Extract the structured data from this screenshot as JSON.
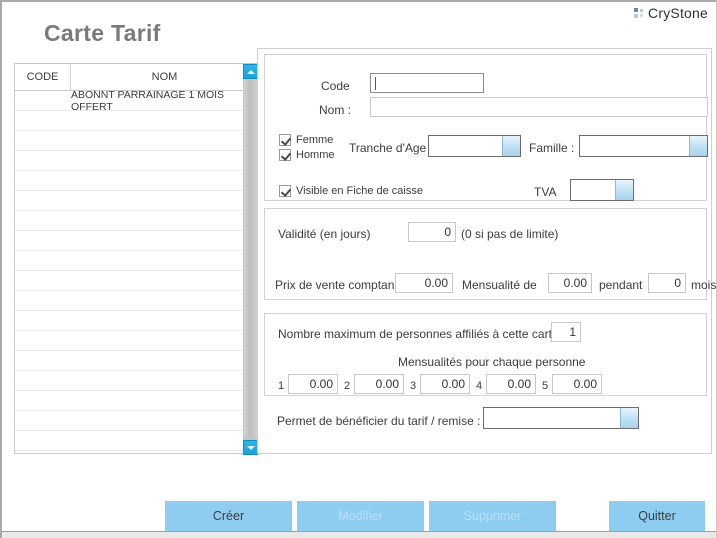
{
  "brand": {
    "name": "CryStone",
    "mark": "crystone-logo-icon"
  },
  "page": {
    "title": "Carte Tarif"
  },
  "list": {
    "columns": [
      "CODE",
      "NOM"
    ],
    "rows": [
      {
        "code": "",
        "nom": "ABONNT PARRAINAGE 1 MOIS OFFERT"
      },
      {
        "code": "",
        "nom": ""
      },
      {
        "code": "",
        "nom": ""
      },
      {
        "code": "",
        "nom": ""
      },
      {
        "code": "",
        "nom": ""
      },
      {
        "code": "",
        "nom": ""
      },
      {
        "code": "",
        "nom": ""
      },
      {
        "code": "",
        "nom": ""
      },
      {
        "code": "",
        "nom": ""
      },
      {
        "code": "",
        "nom": ""
      },
      {
        "code": "",
        "nom": ""
      },
      {
        "code": "",
        "nom": ""
      },
      {
        "code": "",
        "nom": ""
      },
      {
        "code": "",
        "nom": ""
      },
      {
        "code": "",
        "nom": ""
      },
      {
        "code": "",
        "nom": ""
      },
      {
        "code": "",
        "nom": ""
      },
      {
        "code": "",
        "nom": ""
      }
    ],
    "scrollbar": {
      "up": "scroll-up-icon",
      "down": "scroll-down-icon"
    }
  },
  "form": {
    "identity": {
      "code_label": "Code",
      "code_value": "",
      "nom_label": "Nom :",
      "nom_value": "",
      "femme_label": "Femme",
      "homme_label": "Homme",
      "tranche_label": "Tranche d'Age :",
      "tranche_value": "",
      "famille_label": "Famille :",
      "famille_value": "",
      "visible_label": "Visible en Fiche de caisse",
      "tva_label": "TVA",
      "tva_value": ""
    },
    "validity": {
      "validite_label": "Validité (en jours)",
      "validite_value": "0",
      "validite_hint": "(0 si pas de limite)",
      "prix_label": "Prix de vente comptant",
      "prix_value": "0.00",
      "mensualite_label": "Mensualité de",
      "mensualite_value": "0.00",
      "pendant_label": "pendant",
      "pendant_value": "0",
      "mois_label": "mois"
    },
    "affiliates": {
      "nombre_label": "Nombre maximum de personnes affiliés à cette carte :",
      "nombre_value": "1",
      "mensualites_label": "Mensualités pour chaque personne",
      "rows": [
        {
          "index": "1",
          "value": "0.00"
        },
        {
          "index": "2",
          "value": "0.00"
        },
        {
          "index": "3",
          "value": "0.00"
        },
        {
          "index": "4",
          "value": "0.00"
        },
        {
          "index": "5",
          "value": "0.00"
        }
      ]
    },
    "benefit": {
      "label": "Permet de bénéficier du tarif / remise :",
      "value": ""
    }
  },
  "buttons": {
    "creer": "Créer",
    "modifier": "Modifier",
    "supprimer": "Supprimer",
    "quitter": "Quitter"
  },
  "colors": {
    "accent": "#8fcdf0",
    "scroll_arrow": "#18a4dc",
    "title": "#7a7a7a",
    "combo_button": "#bfe0f4"
  }
}
